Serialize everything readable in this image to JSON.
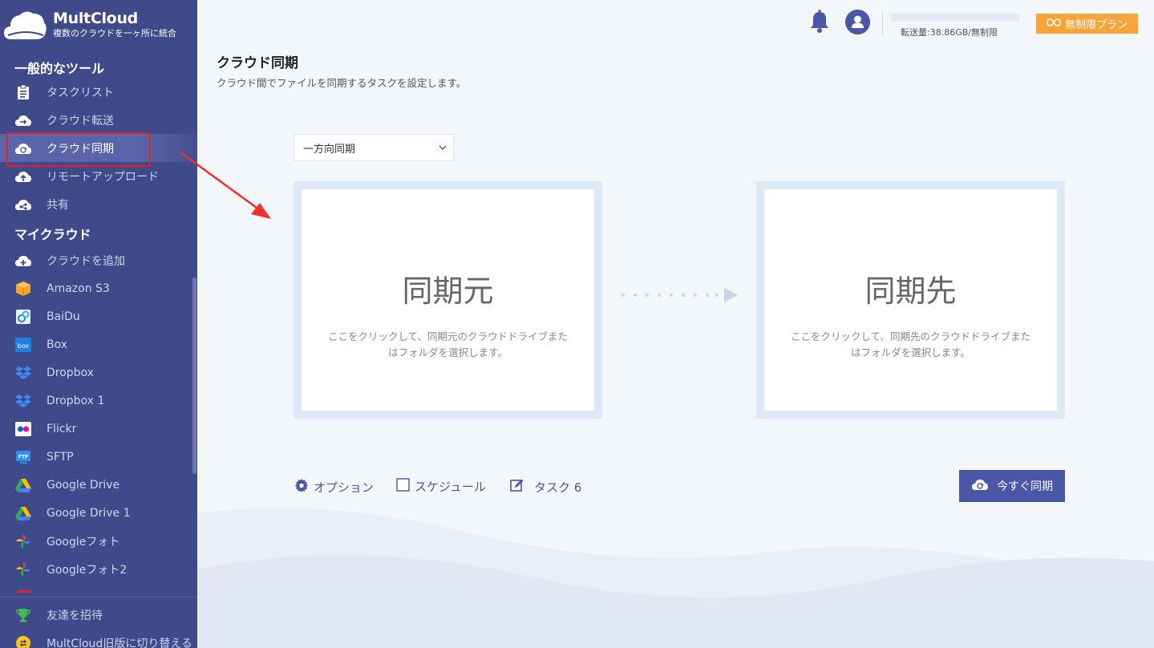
{
  "brand": {
    "name": "MultCloud",
    "tagline": "複数のクラウドを一ヶ所に統合"
  },
  "sidebar": {
    "section_tools": "一般的なツール",
    "tools": [
      {
        "label": "タスクリスト",
        "icon": "clipboard-icon"
      },
      {
        "label": "クラウド転送",
        "icon": "cloud-transfer-icon"
      },
      {
        "label": "クラウド同期",
        "icon": "cloud-sync-icon",
        "active": true
      },
      {
        "label": "リモートアップロード",
        "icon": "cloud-upload-icon"
      },
      {
        "label": "共有",
        "icon": "cloud-share-icon"
      }
    ],
    "section_clouds": "マイクラウド",
    "clouds": [
      {
        "label": "クラウドを追加",
        "icon": "cloud-add-icon"
      },
      {
        "label": "Amazon S3",
        "icon": "amazon-s3-icon"
      },
      {
        "label": "BaiDu",
        "icon": "baidu-icon"
      },
      {
        "label": "Box",
        "icon": "box-icon"
      },
      {
        "label": "Dropbox",
        "icon": "dropbox-icon"
      },
      {
        "label": "Dropbox 1",
        "icon": "dropbox-icon"
      },
      {
        "label": "Flickr",
        "icon": "flickr-icon"
      },
      {
        "label": "SFTP",
        "icon": "sftp-icon"
      },
      {
        "label": "Google Drive",
        "icon": "google-drive-icon"
      },
      {
        "label": "Google Drive 1",
        "icon": "google-drive-icon"
      },
      {
        "label": "Googleフォト",
        "icon": "google-photos-icon"
      },
      {
        "label": "Googleフォト2",
        "icon": "google-photos-icon"
      }
    ],
    "footer": [
      {
        "label": "友達を招待",
        "icon": "trophy-icon"
      },
      {
        "label": "MultCloud旧版に切り替える",
        "icon": "switch-icon"
      }
    ],
    "box_icon_text": "box",
    "sftp_icon_text": "FTP"
  },
  "header": {
    "usage_text": "転送量:38.86GB/無制限",
    "plan_label": "無制限プラン",
    "colors": {
      "accent": "#4a56a6",
      "plan": "#f7a43a",
      "sidebar": "#3f4a8a"
    }
  },
  "main": {
    "title": "クラウド同期",
    "subtitle": "クラウド間でファイルを同期するタスクを設定します。",
    "sync_mode": "一方向同期",
    "source": {
      "title": "同期元",
      "desc": "ここをクリックして、同期元のクラウドドライブまたはフォルダを選択します。"
    },
    "target": {
      "title": "同期先",
      "desc": "ここをクリックして、同期先のクラウドドライブまたはフォルダを選択します。"
    },
    "options_label": "オプション",
    "schedule_label": "スケジュール",
    "task_label": "タスク 6",
    "sync_now_label": "今すぐ同期"
  }
}
